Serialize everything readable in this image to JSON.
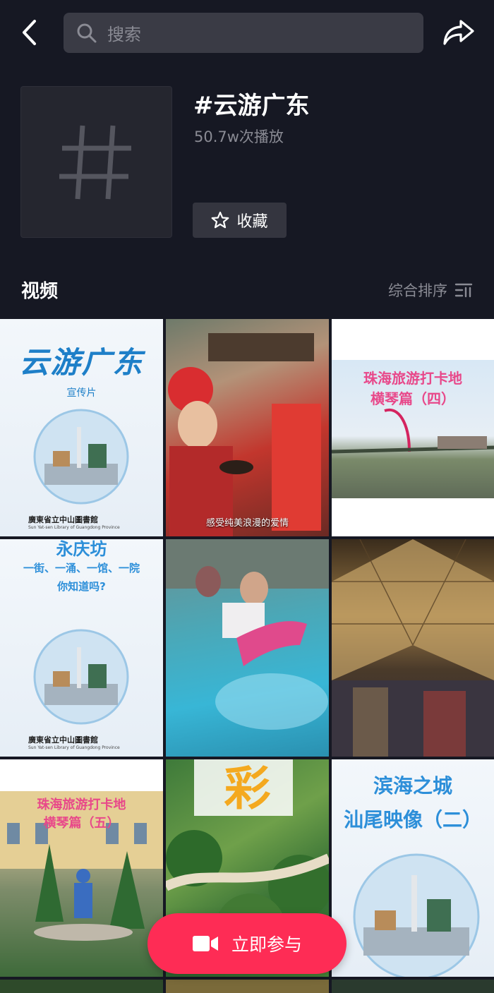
{
  "search": {
    "placeholder": "搜索"
  },
  "header": {
    "title": "#云游广东",
    "plays": "50.7w次播放",
    "favorite_label": "收藏"
  },
  "section": {
    "title": "视频",
    "sort_label": "综合排序"
  },
  "tiles": [
    {
      "title": "云游广东",
      "subtitle": "宣传片",
      "footer": "廣東省立中山圖書館",
      "footer_en": "Sun Yat-sen Library of Guangdong Province"
    },
    {
      "caption": "感受纯美浪漫的爱情"
    },
    {
      "title_line1": "珠海旅游打卡地",
      "title_line2": "横琴篇（四）"
    },
    {
      "title_top": "永庆坊",
      "line1": "一街、一涌、一馆、一院",
      "line2": "你知道吗?",
      "footer": "廣東省立中山圖書館",
      "footer_en": "Sun Yat-sen Library of Guangdong Province"
    },
    {},
    {},
    {
      "title_line1": "珠海旅游打卡地",
      "title_line2": "横琴篇（五）"
    },
    {
      "title": "彩"
    },
    {
      "title_line1": "滨海之城",
      "title_line2": "汕尾映像（二）"
    }
  ],
  "cta": {
    "label": "立即参与"
  },
  "colors": {
    "bg": "#161823",
    "accent": "#fe2c55",
    "muted": "#8a8b94"
  }
}
